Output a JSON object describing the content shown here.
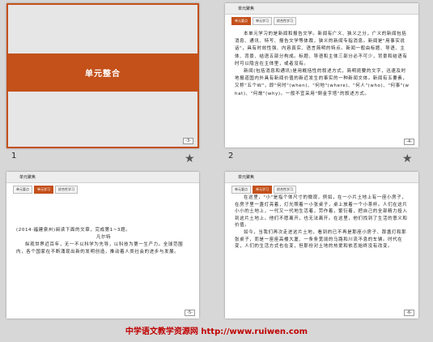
{
  "slide1": {
    "title": "单元整合",
    "page": "-3-"
  },
  "slide2": {
    "header": "单元聚焦",
    "tabs": [
      "单元要点",
      "单元学习",
      "综合性学习"
    ],
    "active_tab": 0,
    "paragraphs": [
      "本单元学习的是新闻和报告文学。新闻有广义、狭义之分，广义的新闻包括消息、通讯、特写、报告文学等体裁，狭义的新闻专指消息。新闻是\"用事实说话\"，具有时效性强、内容真实、语言简明的特点。新闻一般由标题、导语、主体、背景、结语五部分构成。标题、导语和主体三部分必不可少，背景和结语有时可以隐含在主体里，或者没有。",
      "新闻(包括消息和通讯)是用概括性的叙述方式，简明扼要的文字，迅速及时地报道国内外具有新闻价值的新近发生的事实的一种新闻文体。新闻有五要素，又称\"五个W\"，即\"何时\"(when)、\"何地\"(where)、\"何人\"(who)、\"何事\"(what)、\"何故\"(why)。一般不宜采用\"倒金字塔\"的叙述方式。"
    ],
    "page": "-4-"
  },
  "slide3": {
    "header": "单元聚焦",
    "tabs": [
      "单元要点",
      "单元学习",
      "综合性学习"
    ],
    "active_tab": 1,
    "intro": "(2014·福建泉州)阅读下面的文章，完成第1~3题。",
    "title": "凡尔特",
    "paragraph": "纵观世界近百年，无一不以科学为先导，以科技为第一生产力。全球范围内，各个国家在不断涌现出新的发明创造，推动着人类社会的进步与发展。",
    "page": "-5-"
  },
  "slide4": {
    "header": "单元聚焦",
    "tabs": [
      "单元要点",
      "单元学习",
      "综合性学习"
    ],
    "active_tab": 1,
    "paragraphs": [
      "在这里，\"小\"是指个体尺寸的微观，例如，在一小片土地上有一座小房子，在房子里一盏灯亮着，灯光照着一小张桌子，桌上放着一个小茶杯。人们在这片小小的土地上，一代又一代地生活着，劳作着，繁衍着，把自己的全部精力投入到这片土地上。他们不愿离开，也无法离开。在这里，他们找到了生活的意义和价值。",
      "如今，当我们再次走进这片土地，看到的已不再是那座小房子、那盏灯和那张桌子，而是一座座高楼大厦、一条条宽阔的马路和川流不息的车辆。时代在变，人们的生活方式也在变，但那份对土地的热爱和依恋始终没有改变。"
    ],
    "page": "-6-"
  },
  "thumbs": {
    "n1": "1",
    "n2": "2"
  },
  "footer": "中学语文教学资源网 http://www.ruiwen.com"
}
